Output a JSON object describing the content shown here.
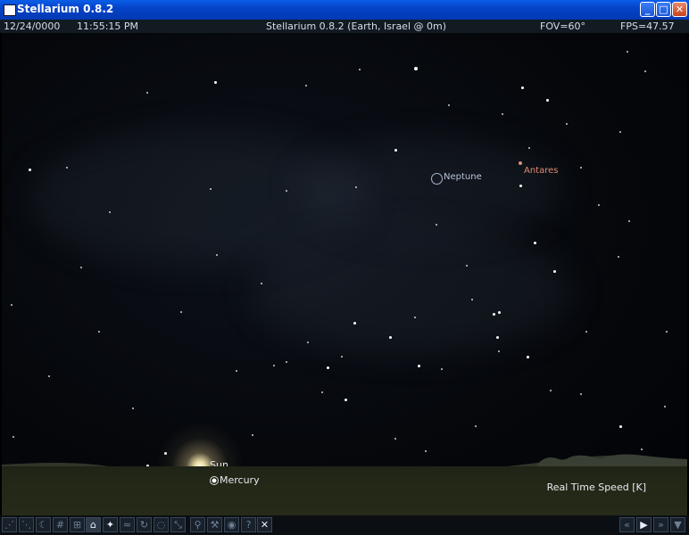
{
  "window": {
    "title": "Stellarium 0.8.2"
  },
  "infobar": {
    "date": "12/24/0000",
    "time": "11:55:15 PM",
    "location": "Stellarium 0.8.2 (Earth, Israel @ 0m)",
    "fov": "FOV=60°",
    "fps": "FPS=47.57"
  },
  "sky": {
    "labels": {
      "neptune": "Neptune",
      "antares": "Antares",
      "sun": "Sun",
      "mercury": "Mercury"
    },
    "speed_text": "Real Time Speed [K]"
  },
  "toolbar": {
    "left_buttons": [
      "constellation-lines-icon",
      "constellation-names-icon",
      "constellation-art-icon",
      "azimuth-grid-icon",
      "equatorial-grid-icon",
      "ground-icon",
      "cardinal-points-icon",
      "atmosphere-icon",
      "nebula-names-icon",
      "planet-names-icon",
      "equatorial-mount-icon",
      "search-icon",
      "config-icon",
      "night-mode-icon",
      "help-icon",
      "quit-icon"
    ],
    "right_buttons": [
      "rewind-icon",
      "play-icon",
      "fast-forward-icon",
      "time-menu-icon"
    ]
  },
  "colors": {
    "title_bar": "#0443c8",
    "antares": "#e08a70",
    "ground": "#232817"
  }
}
